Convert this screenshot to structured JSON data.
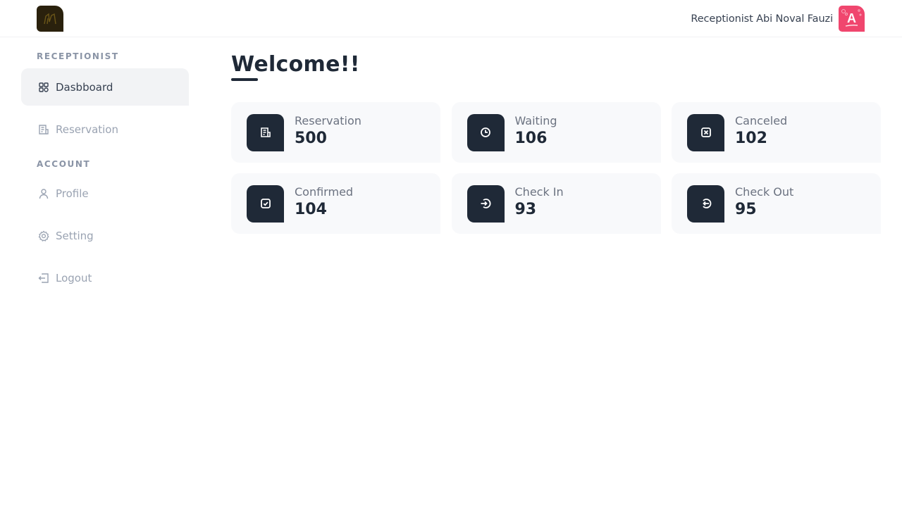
{
  "header": {
    "logo_icon": "hotel-logo-icon",
    "user_name": "Receptionist Abi Noval Fauzi",
    "avatar_letter": "A",
    "avatar_color": "#f0466e"
  },
  "sidebar": {
    "sections": [
      {
        "label": "RECEPTIONIST",
        "items": [
          {
            "label": "Dasbboard",
            "icon": "dashboard-grid-icon",
            "active": true
          },
          {
            "label": "Reservation",
            "icon": "receipt-icon",
            "active": false
          }
        ]
      },
      {
        "label": "ACCOUNT",
        "items": [
          {
            "label": "Profile",
            "icon": "user-icon",
            "active": false
          },
          {
            "label": "Setting",
            "icon": "gear-icon",
            "active": false
          },
          {
            "label": "Logout",
            "icon": "logout-icon",
            "active": false
          }
        ]
      }
    ]
  },
  "main": {
    "title": "Welcome!!",
    "stats": [
      {
        "label": "Reservation",
        "value": "500",
        "icon": "receipt-icon"
      },
      {
        "label": "Waiting",
        "value": "106",
        "icon": "clock-icon"
      },
      {
        "label": "Canceled",
        "value": "102",
        "icon": "x-square-icon"
      },
      {
        "label": "Confirmed",
        "value": "104",
        "icon": "check-square-icon"
      },
      {
        "label": "Check In",
        "value": "93",
        "icon": "check-in-icon"
      },
      {
        "label": "Check Out",
        "value": "95",
        "icon": "check-out-icon"
      }
    ]
  },
  "colors": {
    "primary_dark": "#1f2937",
    "card_bg": "#f8f9fb",
    "active_nav_bg": "#f2f3f5",
    "muted_text": "#9aa3b2"
  }
}
